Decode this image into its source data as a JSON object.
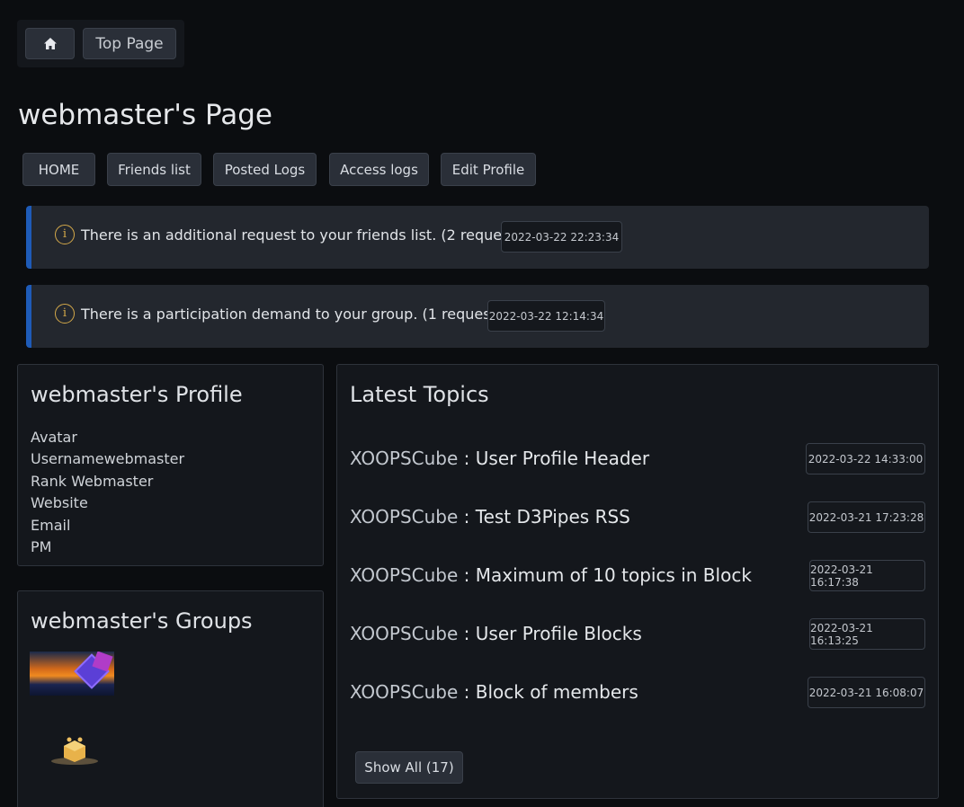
{
  "breadcrumb": {
    "home_icon": "home-icon",
    "top_page": "Top Page"
  },
  "page_title": "webmaster's Page",
  "nav": [
    "HOME",
    "Friends list",
    "Posted Logs",
    "Access logs",
    "Edit Profile"
  ],
  "alerts": [
    {
      "text": "There is an additional request to your friends list. (2 request(s) )",
      "time": "2022-03-22 22:23:34",
      "icon": "info-icon"
    },
    {
      "text": "There is a participation demand to your group. (1 request(s) )",
      "time": "2022-03-22 12:14:34",
      "icon": "info-icon"
    }
  ],
  "profile": {
    "title": "webmaster's Profile",
    "fields": [
      "Avatar",
      "Usernamewebmaster",
      "Rank Webmaster",
      "Website",
      "Email",
      "PM"
    ]
  },
  "groups": {
    "title": "webmaster's Groups"
  },
  "topics": {
    "title": "Latest Topics",
    "items": [
      {
        "site": "XOOPSCube",
        "sep": " : ",
        "title": "User Profile Header",
        "time": "2022-03-22 14:33:00"
      },
      {
        "site": "XOOPSCube",
        "sep": " : ",
        "title": "Test D3Pipes RSS",
        "time": "2022-03-21 17:23:28"
      },
      {
        "site": "XOOPSCube",
        "sep": " : ",
        "title": "Maximum of 10 topics in Block",
        "time": "2022-03-21 16:17:38"
      },
      {
        "site": "XOOPSCube",
        "sep": " : ",
        "title": "User Profile Blocks",
        "time": "2022-03-21 16:13:25"
      },
      {
        "site": "XOOPSCube",
        "sep": " : ",
        "title": "Block of members",
        "time": "2022-03-21 16:08:07"
      }
    ],
    "show_all": "Show All (17)"
  },
  "colors": {
    "background": "#0b0d10",
    "alert_accent": "#1e5bb8",
    "icon_accent": "#d4a94a"
  }
}
